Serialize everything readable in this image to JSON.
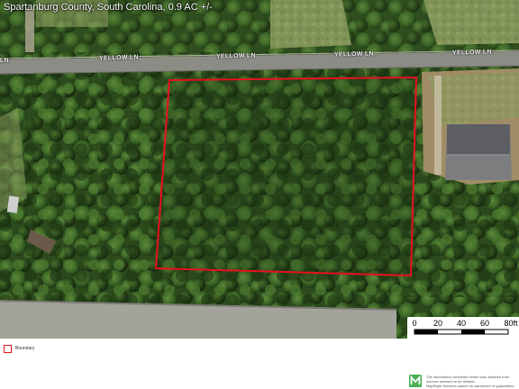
{
  "map": {
    "title": "Spartanburg County, South Carolina, 0.9 AC +/-",
    "road_labels": [
      "LN",
      "YELLOW LN",
      "YELLOW LN",
      "YELLOW LN",
      "YELLOW LN"
    ],
    "boundary_color": "#e8101f",
    "imagery": "aerial-satellite"
  },
  "scale": {
    "labels": [
      "0",
      "20",
      "40",
      "60",
      "80ft"
    ]
  },
  "legend": {
    "items": [
      {
        "label": "Boundary",
        "color": "#e8101f",
        "icon": "boundary-outline-icon"
      }
    ]
  },
  "footer": {
    "logo_icon": "mapright-logo-icon",
    "logo_color": "#4caf50",
    "disclaimer_lines": [
      "The information contained herein was obtained from",
      "sources deemed to be reliable.",
      "MapRight Services makes no warranties or guarantees"
    ]
  }
}
